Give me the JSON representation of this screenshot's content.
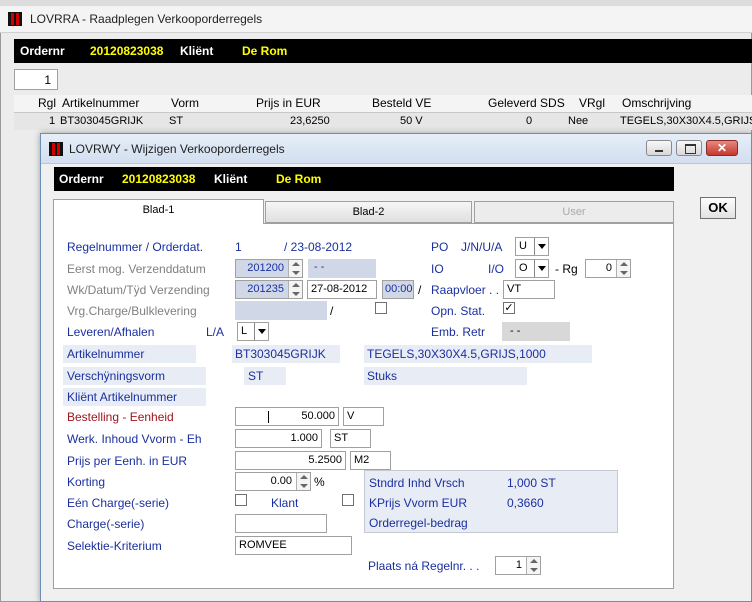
{
  "colors": {
    "accent_blue": "#1a2fa0",
    "black_bar": "#000000",
    "yellow_value": "#ffff00",
    "label_red": "#a0141e",
    "close_red": "#c7372f"
  },
  "bg_window": {
    "title": "LOVRRA - Raadplegen Verkooporderregels",
    "header": {
      "ordernr_label": "Ordernr",
      "ordernr_value": "20120823038",
      "client_label": "Kliënt",
      "client_value": "De Rom"
    },
    "page_field": "1",
    "table": {
      "columns": [
        "Rgl",
        "Artikelnummer",
        "Vorm",
        "Prijs in EUR",
        "Besteld VE",
        "Geleverd SDS",
        "VRgl",
        "Omschrijving"
      ],
      "row": [
        "1",
        "BT303045GRIJK",
        "ST",
        "23,6250",
        "50 V",
        "0",
        "Nee",
        "TEGELS,30X30X4.5,GRIJS"
      ]
    }
  },
  "dialog": {
    "title": "LOVRWY - Wijzigen Verkooporderregels",
    "header": {
      "ordernr_label": "Ordernr",
      "ordernr_value": "20120823038",
      "client_label": "Kliënt",
      "client_value": "De Rom"
    },
    "ok_label": "OK",
    "tabs": [
      "Blad-1",
      "Blad-2",
      "User"
    ],
    "form": {
      "regelnummer_label": "Regelnummer / Orderdat.",
      "regelnummer_value": "1",
      "orderdat_value": "/ 23-08-2012",
      "po_label": "PO",
      "jnua_label": "J/N/U/A",
      "jnua_value": "U",
      "eerst_label": "Eerst mog. Verzenddatum",
      "eerst_value": "201200",
      "eerst_extra": "- -",
      "io_label": "IO",
      "io2_label": "I/O",
      "io_value": "O",
      "rg_label": "- Rg",
      "rg_value": "0",
      "wk_label": "Wk/Datum/Tÿd Verzending",
      "wk_value": "201235",
      "date_value": "27-08-2012",
      "time_value": "00:00",
      "slash": "/",
      "raapvloer_label": "Raapvloer . .",
      "raapvloer_value": "VT",
      "vrg_label": "Vrg.Charge/Bulklevering",
      "vrg_slash": "/",
      "opn_label": "Opn. Stat.",
      "leveren_label": "Leveren/Afhalen",
      "la_label": "L/A",
      "la_value": "L",
      "emb_label": "Emb. Retr",
      "emb_value": "- -",
      "artikel_label": "Artikelnummer",
      "artikel_value": "BT303045GRIJK",
      "artikel_desc": "TEGELS,30X30X4.5,GRIJS,1000",
      "vorm_label": "Verschÿningsvorm",
      "vorm_value": "ST",
      "vorm_desc": "Stuks",
      "klant_art_label": "Kliënt Artikelnummer",
      "bestelling_label": "Bestelling - Eenheid",
      "bestelling_value": "50.000",
      "bestelling_unit": "V",
      "werk_label": "Werk. Inhoud Vvorm - Eh",
      "werk_value": "1.000",
      "werk_unit": "ST",
      "prijs_label": "Prijs per Eenh. in EUR",
      "prijs_value": "5.2500",
      "prijs_unit": "M2",
      "korting_label": "Korting",
      "korting_value": "0.00",
      "korting_unit": "%",
      "een_label": "Eén Charge(-serie)",
      "klant_label": "Klant",
      "charge_label": "Charge(-serie)",
      "selektie_label": "Selektie-Kriterium",
      "selektie_value": "ROMVEE",
      "stndrd_label": "Stndrd Inhd Vrsch",
      "stndrd_value": "1,000 ST",
      "kprijs_label": "KPrijs Vvorm  EUR",
      "kprijs_value": "0,3660",
      "orderregel_label": "Orderregel-bedrag",
      "plaats_label": "Plaats ná Regelnr. . .",
      "plaats_value": "1"
    }
  }
}
